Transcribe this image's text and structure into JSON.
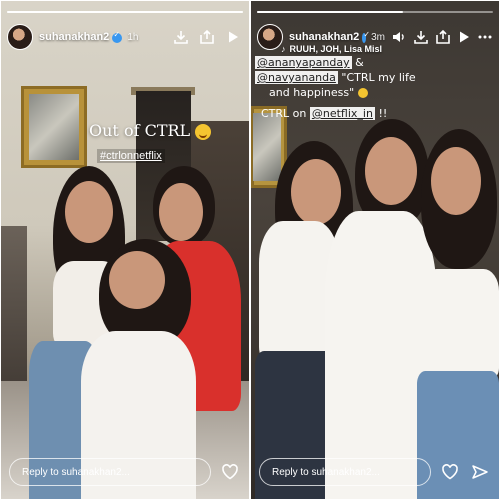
{
  "left_story": {
    "username": "suhanakhan2",
    "time": "1h",
    "progress": 1,
    "caption": "Out of CTRL",
    "emoji": "winking-tongue-face",
    "hashtag": "#ctrlonnetflix",
    "reply_placeholder": "Reply to suhanakhan2..."
  },
  "right_story": {
    "username": "suhanakhan2",
    "time": "3m",
    "progress": 0.62,
    "subline": "RUUH, JOH, Lisa Misl",
    "caption_lines": [
      {
        "tag": "@ananyapanday",
        "text": " &"
      },
      {
        "tag": "@navyananda",
        "text": " \"CTRL my life"
      },
      {
        "tag": "",
        "text": "and happiness\""
      }
    ],
    "ctrl_prefix": "CTRL on ",
    "ctrl_tag": "@netflix_in",
    "ctrl_suffix": " !!",
    "reply_placeholder": "Reply to suhanakhan2..."
  },
  "colors": {
    "verified": "#3897f0",
    "tag_background": "#ffffff",
    "text": "#ffffff"
  },
  "icons": {
    "left_top": [
      "download-icon",
      "share-icon",
      "play-icon"
    ],
    "right_top": [
      "volume-icon",
      "download-icon",
      "share-icon",
      "play-icon",
      "more-icon"
    ],
    "left_bottom": [
      "heart-icon"
    ],
    "right_bottom": [
      "heart-icon",
      "send-icon"
    ]
  }
}
